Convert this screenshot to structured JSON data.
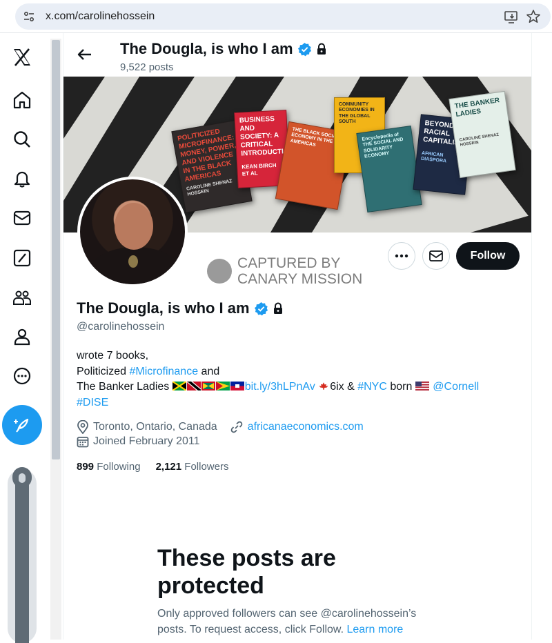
{
  "browser": {
    "url": "x.com/carolinehossein",
    "icons": [
      "site-info-icon",
      "install-app-icon",
      "bookmark-star-icon"
    ]
  },
  "nav": {
    "items": [
      "x-logo-icon",
      "home-icon",
      "search-icon",
      "notifications-icon",
      "messages-icon",
      "grok-icon",
      "communities-icon",
      "profile-icon",
      "more-icon"
    ],
    "compose_icon": "compose-feather-icon"
  },
  "header": {
    "name": "The Dougla, is who I am",
    "posts": "9,522 posts"
  },
  "banner": {
    "books": [
      {
        "title": "POLITICIZED MICROFINANCE: MONEY, POWER, AND VIOLENCE IN THE BLACK AMERICAS",
        "author": "CAROLINE SHENAZ HOSSEIN"
      },
      {
        "title": "BUSINESS AND SOCIETY: A CRITICAL INTRODUCTION",
        "author": "KEAN BIRCH ET AL"
      },
      {
        "title": "THE BLACK SOCIAL ECONOMY IN THE AMERICAS"
      },
      {
        "title": "COMMUNITY ECONOMIES IN THE GLOBAL SOUTH"
      },
      {
        "title": "Encyclopedia of THE SOCIAL AND SOLIDARITY ECONOMY"
      },
      {
        "title": "BEYOND RACIAL CAPITALISM",
        "subtitle": "AFRICAN DIASPORA"
      },
      {
        "title": "THE BANKER LADIES",
        "author": "CAROLINE SHENAZ HOSSEIN"
      }
    ]
  },
  "actions": {
    "follow_label": "Follow"
  },
  "watermark": {
    "line1": "CAPTURED BY",
    "line2": "CANARY MISSION"
  },
  "profile": {
    "name": "The Dougla, is who I am",
    "handle": "@carolinehossein",
    "bio": {
      "line1": "wrote 7 books,",
      "line2_text": "Politicized ",
      "line2_link": "#Microfinance",
      "line2_end": " and",
      "line3_text": "The Banker Ladies ",
      "line3_link1": "bit.ly/3hLPnAv",
      "line3_mid": "6ix & ",
      "line3_link2": "#NYC",
      "line3_mid2": " born ",
      "line3_link3": "@Cornell",
      "line4_link": "#DISE"
    },
    "location": "Toronto, Ontario, Canada",
    "website": "africanaeconomics.com",
    "joined": "Joined February 2011",
    "following_count": "899",
    "following_label": "Following",
    "followers_count": "2,121",
    "followers_label": "Followers"
  },
  "protected": {
    "title": "These posts are protected",
    "text": "Only approved followers can see @carolinehossein’s posts. To request access, click Follow. ",
    "link": "Learn more"
  },
  "colors": {
    "accent": "#1d9bf0",
    "text": "#0f1419",
    "muted": "#536471"
  }
}
